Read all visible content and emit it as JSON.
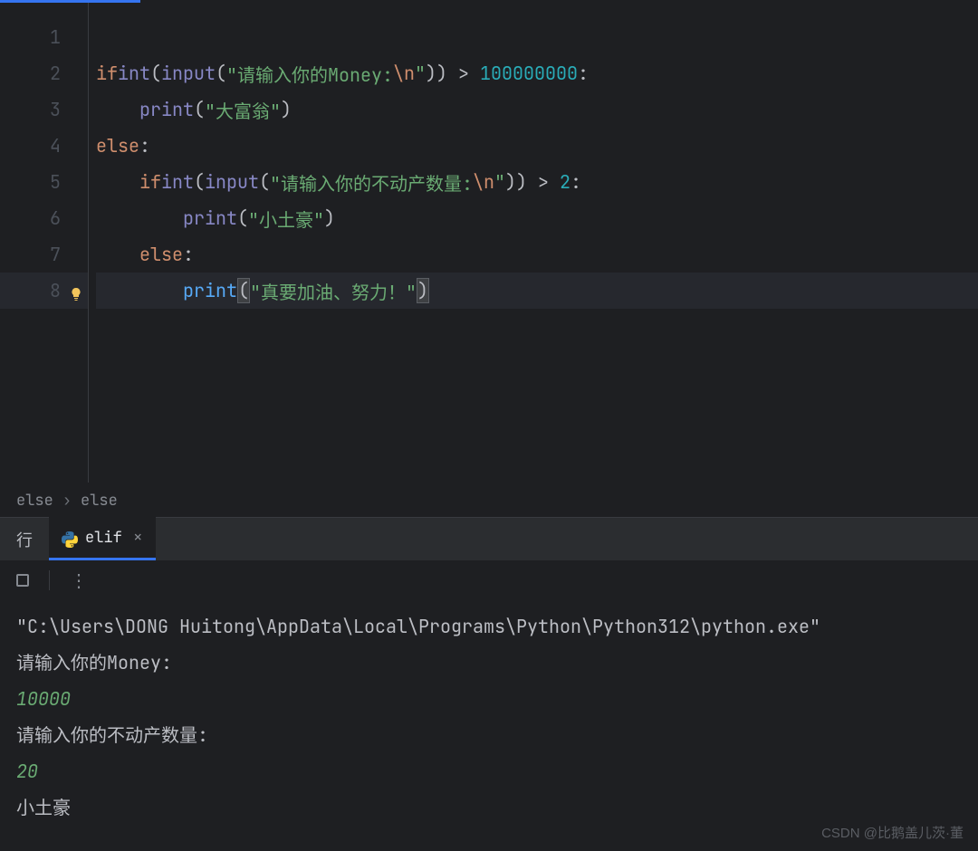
{
  "gutter": {
    "lines": [
      "1",
      "2",
      "3",
      "4",
      "5",
      "6",
      "7",
      "8"
    ]
  },
  "code": {
    "line2": {
      "kw_if": "if",
      "fn_int": "int",
      "fn_input": "input",
      "str_prefix": "\"请输入你的Money:",
      "esc": "\\n",
      "str_suffix": "\"",
      "op_gt": " > ",
      "num": "100000000",
      "colon": ":"
    },
    "line3": {
      "indent": "    ",
      "fn_print": "print",
      "str": "\"大富翁\""
    },
    "line4": {
      "kw_else": "else",
      "colon": ":"
    },
    "line5": {
      "indent": "    ",
      "kw_if": "if",
      "fn_int": "int",
      "fn_input": "input",
      "str_prefix": "\"请输入你的不动产数量:",
      "esc": "\\n",
      "str_suffix": "\"",
      "op_gt": " > ",
      "num": "2",
      "colon": ":"
    },
    "line6": {
      "indent": "        ",
      "fn_print": "print",
      "str": "\"小土豪\""
    },
    "line7": {
      "indent": "    ",
      "kw_else": "else",
      "colon": ":"
    },
    "line8": {
      "indent": "        ",
      "fn_print": "print",
      "paren_open": "(",
      "str": "\"真要加油、努力！\"",
      "paren_close": ")"
    }
  },
  "breadcrumb": {
    "item1": "else",
    "item2": "else"
  },
  "tab": {
    "prefix": "行",
    "label": "elif"
  },
  "terminal": {
    "line1": "\"C:\\Users\\DONG Huitong\\AppData\\Local\\Programs\\Python\\Python312\\python.exe\"",
    "line2": "请输入你的Money:",
    "line3": "10000",
    "line4": "请输入你的不动产数量:",
    "line5": "20",
    "line6": "小土豪"
  },
  "watermark": "CSDN @比鹅盖儿茨·董"
}
